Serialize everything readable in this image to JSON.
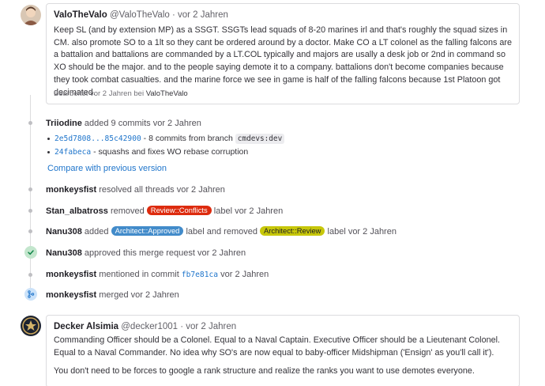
{
  "comments": [
    {
      "author": "ValoTheValo",
      "handle": "@ValoTheValo",
      "time": "· vor 2 Jahren",
      "paragraphs": [
        "Keep SL (and by extension MP) as a SSGT. SSGTs lead squads of 8-20 marines irl and that's roughly the squad sizes in CM. also promote SO to a 1lt so they cant be ordered around by a doctor. Make CO a LT colonel as the falling falcons are a battalion and battalions are commanded by a LT.COL typically and majors are usally a desk job or 2nd in command so XO should be the major. and to the people saying demote it to a company. battalions don't become companies because they took combat casualties. and the marine force we see in game is half of the falling falcons because 1st Platoon got decimated."
      ],
      "edited_prefix": "Bearbeitet vor 2 Jahren bei",
      "edited_by": "ValoTheValo"
    },
    {
      "author": "Decker Alsimia",
      "handle": "@decker1001",
      "time": "· vor 2 Jahren",
      "paragraphs": [
        "Commanding Officer should be a Colonel. Equal to a Naval Captain. Executive Officer should be a Lieutenant Colonel. Equal to a Naval Commander. No idea why SO's are now equal to baby-officer Midshipman ('Ensign' as you'll call it').",
        "You don't need to be forces to google a rank structure and realize the ranks you want to use demotes everyone."
      ]
    }
  ],
  "events": {
    "commits": {
      "author": "Triiodine",
      "action": "added 9 commits vor 2 Jahren",
      "items": [
        {
          "hash": "2e5d7808...85c42900",
          "text": " - 8 commits from branch ",
          "branch": "cmdevs:dev"
        },
        {
          "hash": "24fabeca",
          "text": " - squashs and fixes WO rebase corruption"
        }
      ],
      "compare_link": "Compare with previous version"
    },
    "resolved": {
      "author": "monkeysfist",
      "text": "resolved all threads vor 2 Jahren"
    },
    "label_removed": {
      "author": "Stan_albatross",
      "pre": "removed",
      "label": "Review::Conflicts",
      "post": "label vor 2 Jahren"
    },
    "labels_changed": {
      "author": "Nanu308",
      "pre": "added",
      "label_added": "Architect::Approved",
      "mid": "label and removed",
      "label_removed": "Architect::Review",
      "post": "label vor 2 Jahren"
    },
    "approved": {
      "author": "Nanu308",
      "text": "approved this merge request vor 2 Jahren"
    },
    "mentioned": {
      "author": "monkeysfist",
      "pre": "mentioned in commit",
      "commit": "fb7e81ca",
      "post": "vor 2 Jahren"
    },
    "merged": {
      "author": "monkeysfist",
      "text": "merged vor 2 Jahren"
    }
  },
  "colors": {
    "conflicts_label": "#dd2b0e",
    "approved_label": "#428bca",
    "review_label": "#c7c70a",
    "approved_icon": "#108548",
    "merged_icon": "#1f75cb",
    "link": "#1f75cb"
  },
  "icons": {
    "approved": "check-circle-icon",
    "merged": "merge-icon"
  }
}
